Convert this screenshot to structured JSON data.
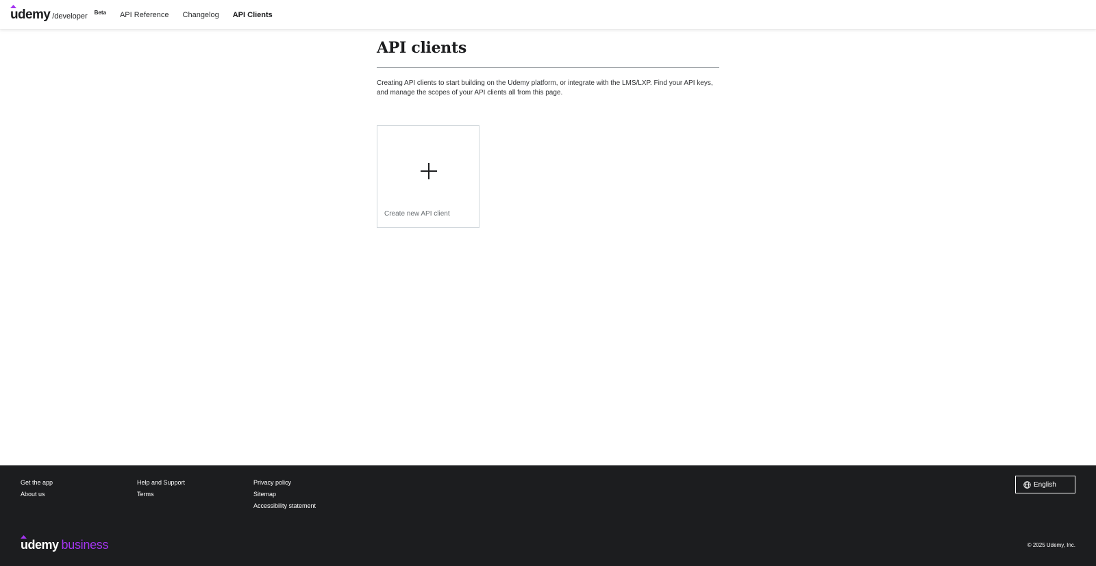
{
  "header": {
    "logo_text": "udemy",
    "logo_suffix": "/developer",
    "badge": "Beta",
    "nav": [
      {
        "label": "API Reference",
        "active": false
      },
      {
        "label": "Changelog",
        "active": false
      },
      {
        "label": "API Clients",
        "active": true
      }
    ]
  },
  "main": {
    "title": "API clients",
    "description": "Creating API clients to start building on the Udemy platform, or integrate with the LMS/LXP. Find your API keys, and manage the scopes of your API clients all from this page.",
    "create_card": {
      "label": "Create new API client",
      "icon": "plus-icon"
    }
  },
  "footer": {
    "columns": [
      [
        "Get the app",
        "About us"
      ],
      [
        "Help and Support",
        "Terms"
      ],
      [
        "Privacy policy",
        "Sitemap",
        "Accessibility statement"
      ]
    ],
    "language_button": "English",
    "language_icon": "globe-icon",
    "logo_text": "udemy",
    "logo_suffix": "business",
    "copyright": "© 2025 Udemy, Inc."
  },
  "colors": {
    "brand_purple": "#a435f0",
    "footer_bg": "#1c1d1f",
    "text": "#1c1d1f"
  }
}
